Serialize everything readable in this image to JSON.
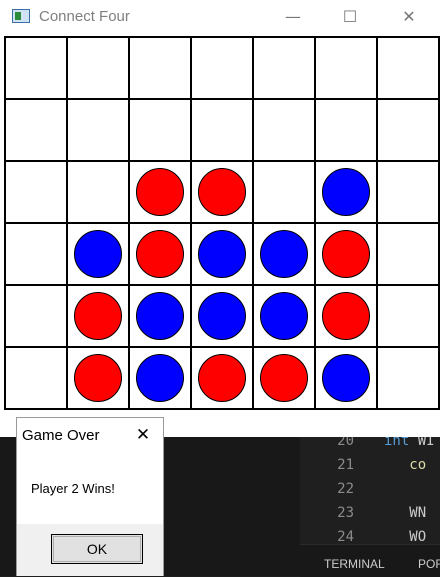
{
  "window": {
    "title": "Connect Four",
    "controls": {
      "minimize": "—",
      "maximize": "☐",
      "close": "✕"
    }
  },
  "board": {
    "rows": 6,
    "cols": 7,
    "colors": {
      "red": "#ff0000",
      "blue": "#0000ff"
    },
    "grid": [
      [
        "",
        "",
        "",
        "",
        "",
        "",
        ""
      ],
      [
        "",
        "",
        "",
        "",
        "",
        "",
        ""
      ],
      [
        "",
        "",
        "red",
        "red",
        "",
        "blue",
        ""
      ],
      [
        "",
        "blue",
        "red",
        "blue",
        "blue",
        "red",
        ""
      ],
      [
        "",
        "red",
        "blue",
        "blue",
        "blue",
        "red",
        ""
      ],
      [
        "",
        "red",
        "blue",
        "red",
        "red",
        "blue",
        ""
      ]
    ]
  },
  "dialog": {
    "title": "Game Over",
    "message": "Player 2 Wins!",
    "ok_label": "OK",
    "close_glyph": "✕"
  },
  "editor": {
    "lines": [
      {
        "num": "20",
        "keyword": "int",
        "text": " WI"
      },
      {
        "num": "21",
        "keyword": "",
        "text": "   co"
      },
      {
        "num": "22",
        "keyword": "",
        "text": ""
      },
      {
        "num": "23",
        "keyword": "",
        "text": "   WN"
      },
      {
        "num": "24",
        "keyword": "",
        "text": "   WO"
      }
    ],
    "tabs": [
      "TERMINAL",
      "POR"
    ]
  }
}
